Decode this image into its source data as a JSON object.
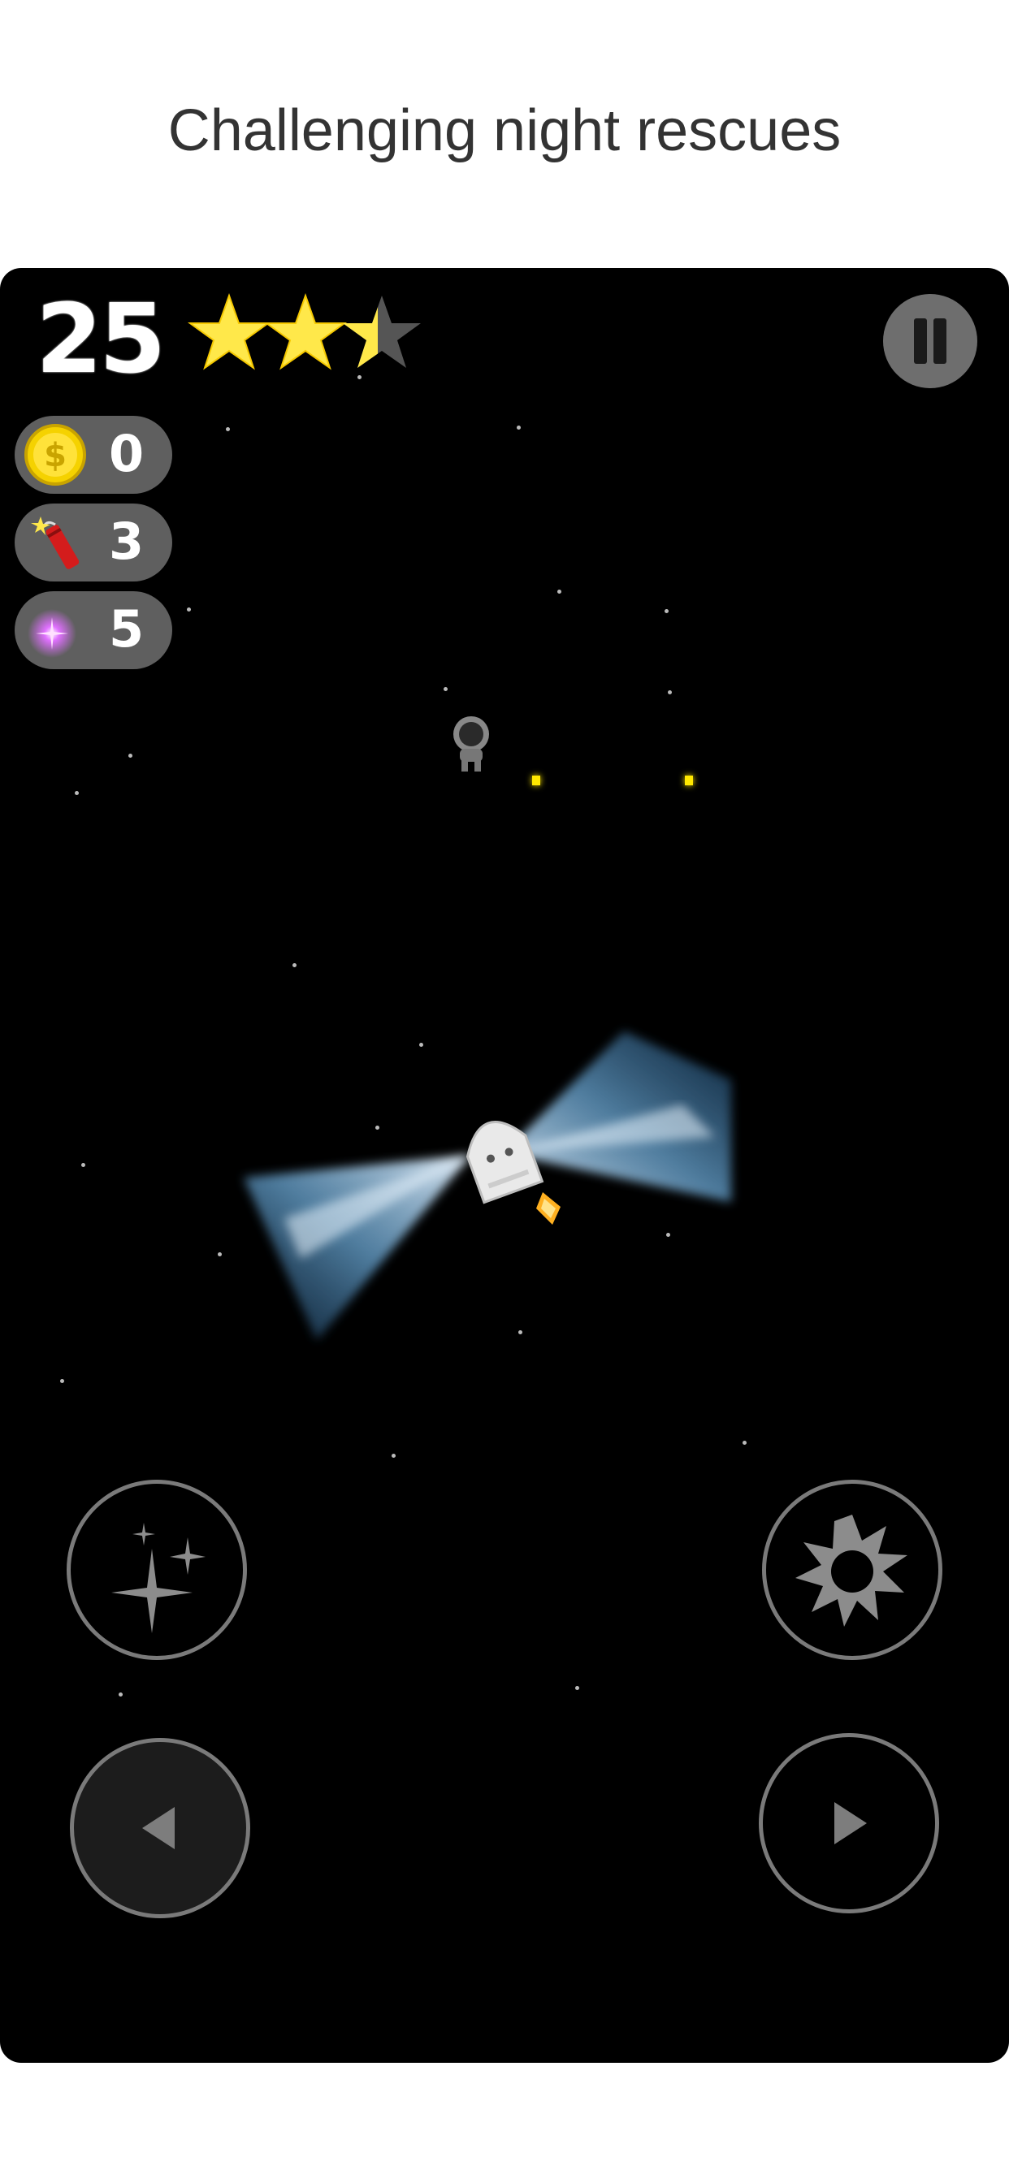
{
  "caption": "Challenging night rescues",
  "hud": {
    "score": "25",
    "stars_earned": 2.5,
    "stars_total": 3,
    "coins": "0",
    "dynamite": "3",
    "flares": "5"
  },
  "icons": {
    "pause": "pause-icon",
    "coin": "coin-icon",
    "dynamite": "dynamite-icon",
    "flare": "flare-icon",
    "sparkle": "sparkle-icon",
    "burst": "explosion-icon",
    "left": "arrow-left-icon",
    "right": "arrow-right-icon"
  },
  "colors": {
    "star": "#ffe84a",
    "coin": "#f5d200",
    "beam": "#9fd4ff",
    "thruster": "#ffb020"
  }
}
